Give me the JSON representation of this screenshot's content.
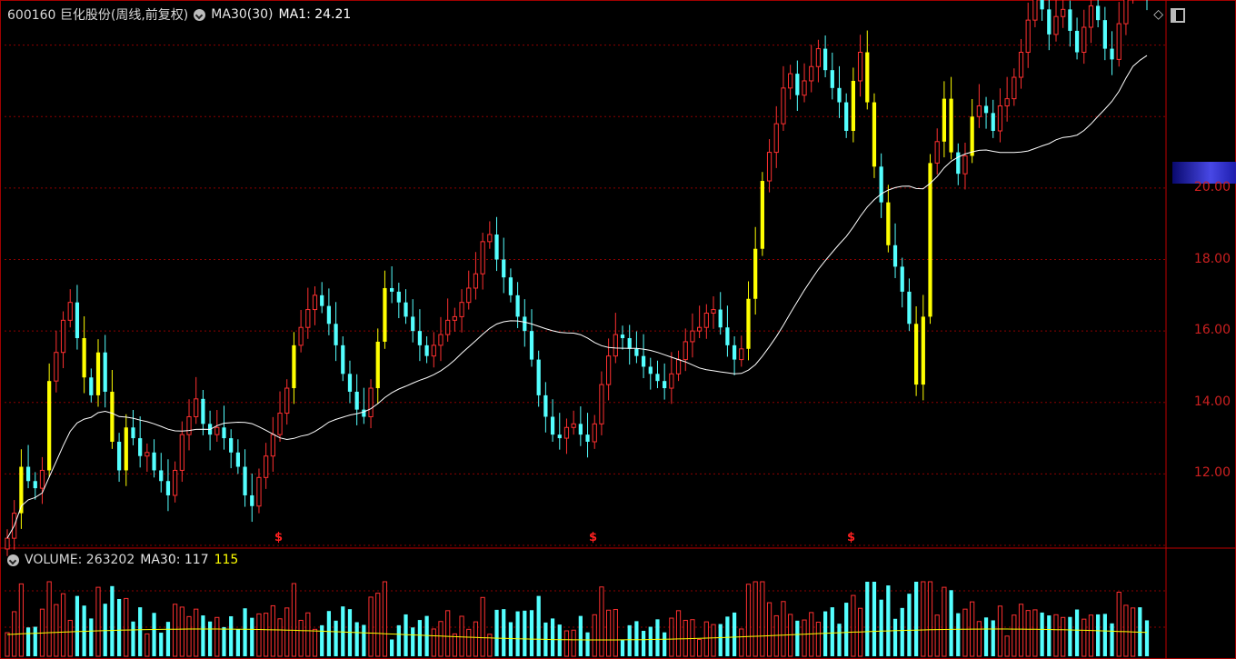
{
  "header": {
    "title": "600160 巨化股份(周线,前复权)",
    "ma_indicator_label": "MA30(30)",
    "ma1_value": "MA1: 24.21"
  },
  "volume_header": {
    "volume_text": "VOLUME: 263202",
    "ma_text": "MA30: 117",
    "ma_value_tail": "115"
  },
  "y_axis": {
    "ticks": [
      "20.00",
      "18.00",
      "16.00",
      "14.00",
      "12.00"
    ]
  },
  "markers": [
    "$",
    "$",
    "$"
  ],
  "icons": {
    "ruler": "diamond-icon",
    "panel": "panel-toggle-icon",
    "menu": "chevron-circle-icon"
  },
  "colors": {
    "background": "#000000",
    "up_candle": "#ff3030",
    "down_candle": "#54ffff",
    "gap_candle": "#ffff00",
    "ma_line": "#ffffff",
    "vol_ma_line": "#ffff00",
    "grid": "#8b0000",
    "axis_text": "#cc2020"
  },
  "chart_data": {
    "type": "candlestick",
    "title": "600160 巨化股份(周线,前复权)",
    "ylim": [
      10.0,
      24.5
    ],
    "y_ticks": [
      12,
      14,
      16,
      18,
      20
    ],
    "grid": true,
    "candles_close": [
      10.2,
      10.9,
      12.2,
      11.8,
      11.6,
      12.1,
      14.6,
      15.4,
      16.3,
      16.8,
      15.8,
      14.7,
      14.2,
      15.4,
      14.3,
      12.9,
      12.1,
      13.3,
      13.0,
      12.5,
      12.6,
      12.1,
      11.8,
      11.4,
      12.1,
      13.1,
      13.6,
      14.1,
      13.4,
      13.1,
      13.3,
      13.0,
      12.6,
      12.2,
      11.4,
      11.1,
      11.9,
      12.5,
      13.1,
      13.7,
      14.4,
      15.6,
      16.1,
      16.6,
      17.0,
      16.7,
      16.2,
      15.6,
      14.8,
      14.3,
      13.8,
      13.6,
      14.4,
      15.7,
      17.2,
      17.1,
      16.8,
      16.4,
      16.0,
      15.6,
      15.3,
      15.6,
      15.9,
      16.3,
      16.4,
      16.8,
      17.2,
      17.6,
      18.5,
      18.7,
      18.0,
      17.5,
      17.0,
      16.4,
      16.0,
      15.2,
      14.2,
      13.6,
      13.1,
      13.0,
      13.3,
      13.4,
      13.1,
      12.9,
      13.4,
      14.5,
      15.3,
      15.9,
      15.8,
      15.5,
      15.3,
      15.0,
      14.8,
      14.6,
      14.4,
      14.8,
      15.2,
      15.7,
      16.0,
      16.1,
      16.5,
      16.6,
      16.1,
      15.6,
      15.2,
      15.5,
      16.9,
      18.3,
      20.2,
      21.0,
      21.8,
      22.8,
      23.2,
      22.6,
      23.0,
      23.4,
      23.9,
      23.3,
      22.8,
      22.4,
      21.6,
      23.0,
      23.8,
      22.4,
      20.6,
      19.6,
      18.4,
      17.8,
      17.1,
      16.2,
      14.5,
      16.4,
      20.7,
      21.3,
      22.5,
      21.0,
      20.4,
      20.9,
      22.0,
      22.3,
      22.1,
      21.6,
      22.3,
      22.5,
      23.1,
      23.8,
      24.7,
      25.4,
      25.0,
      24.3,
      24.8,
      25.0,
      24.4,
      23.8,
      24.5,
      25.1,
      24.7,
      23.9,
      23.6,
      24.6,
      25.6,
      26.3,
      25.8,
      25.3
    ],
    "ma30_line_label": "MA30(30)",
    "ma1_last": 24.21,
    "volume_last": 263202,
    "volume_ma30_label": "MA30"
  }
}
